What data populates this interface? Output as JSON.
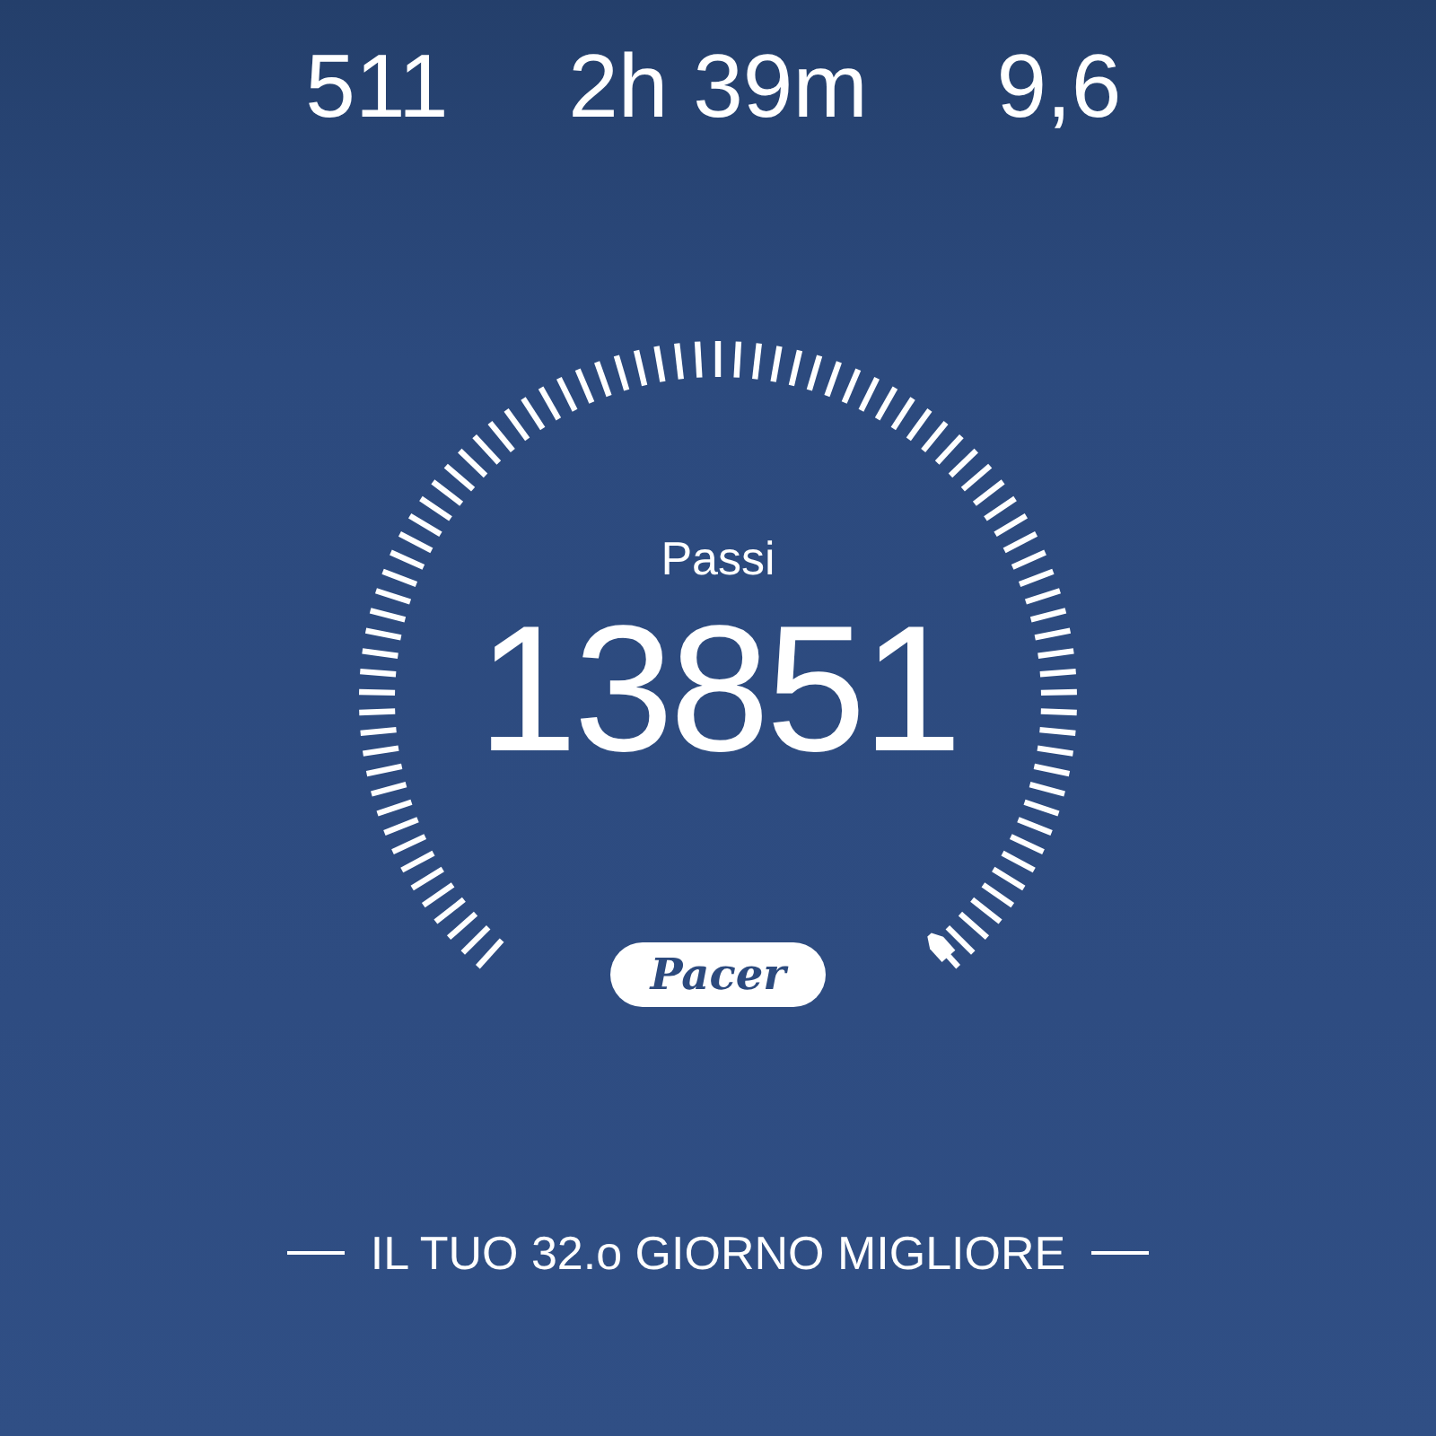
{
  "stats": [
    {
      "value": "511"
    },
    {
      "value": "2h 39m"
    },
    {
      "value": "9,6"
    }
  ],
  "gauge": {
    "label": "Passi",
    "value": "13851"
  },
  "logo": "Pacer",
  "footer": "IL TUO 32.o GIORNO MIGLIORE"
}
